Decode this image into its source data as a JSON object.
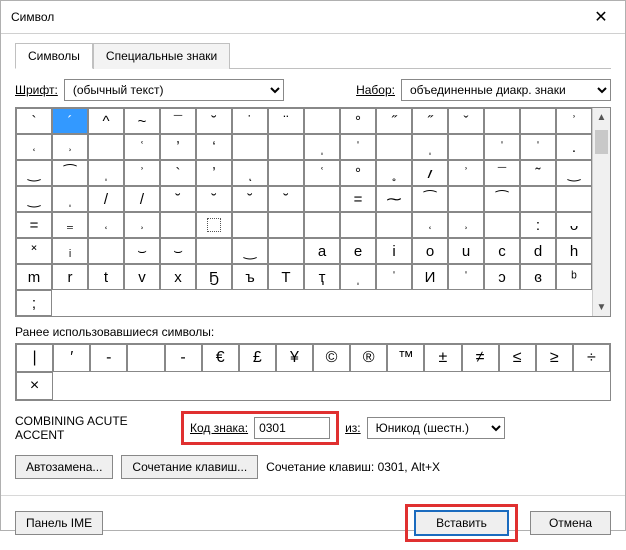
{
  "title": "Символ",
  "tabs": {
    "symbols": "Символы",
    "special": "Специальные знаки"
  },
  "font_label": "Шрифт:",
  "font_value": "(обычный текст)",
  "set_label": "Набор:",
  "set_value": "объединенные диакр. знаки",
  "grid": [
    [
      "`",
      "´",
      "^",
      "~",
      "¯",
      "˘",
      "˙",
      "¨",
      " ",
      "°",
      "˝",
      "˝",
      "ˇ",
      " ",
      " ",
      "ʾ"
    ],
    [
      "˓",
      "˒",
      "",
      "ʿ",
      "ʼ",
      "ʻ",
      "",
      "",
      "ˌ",
      "ˈ",
      "",
      "ˌ",
      "",
      "ˈ",
      "ˈ",
      "."
    ],
    [
      "‿",
      "⁀",
      "ˌ",
      "ʾ",
      "`",
      "ʼ",
      "ͅ",
      " ",
      "ʿ",
      "°",
      "˳",
      "؍",
      "ʾ",
      "¯",
      "˜",
      "‿"
    ],
    [
      "‿",
      "ˌ",
      "/",
      "/",
      "˘",
      "˘",
      "˘",
      "˘",
      "",
      "=",
      "⁓",
      "⁀",
      "",
      "⁀",
      "",
      ""
    ],
    [
      "=",
      "₌",
      "˓",
      "˒",
      "",
      "⬚",
      "",
      "",
      "",
      "",
      "",
      "˓",
      "˒",
      "",
      ":",
      "ᴗ"
    ],
    [
      "˟",
      "ᵢ",
      "",
      "⌣",
      "⌣",
      "",
      "‿",
      "",
      "a",
      "e",
      "i",
      "o",
      "u",
      "c",
      "d",
      "h"
    ],
    [
      "m",
      "r",
      "t",
      "v",
      "x",
      "Ҕ",
      "ъ",
      "Т",
      "ҭ",
      "ˌ",
      "ˈ",
      "И",
      "ˈ",
      "ᴐ",
      "ɞ",
      "ᵇ",
      ";"
    ]
  ],
  "recent_label": "Ранее использовавшиеся символы:",
  "recent": [
    "|",
    "′",
    "-",
    "",
    "-",
    "€",
    "£",
    "¥",
    "©",
    "®",
    "™",
    "±",
    "≠",
    "≤",
    "≥",
    "÷",
    "×"
  ],
  "char_name": "COMBINING ACUTE ACCENT",
  "code_label": "Код знака:",
  "code_value": "0301",
  "from_label": "из:",
  "from_value": "Юникод (шестн.)",
  "autocorrect": "Автозамена...",
  "shortcut_btn": "Сочетание клавиш...",
  "shortcut_text": "Сочетание клавиш: 0301, Alt+X",
  "ime_panel": "Панель IME",
  "insert": "Вставить",
  "cancel": "Отмена"
}
